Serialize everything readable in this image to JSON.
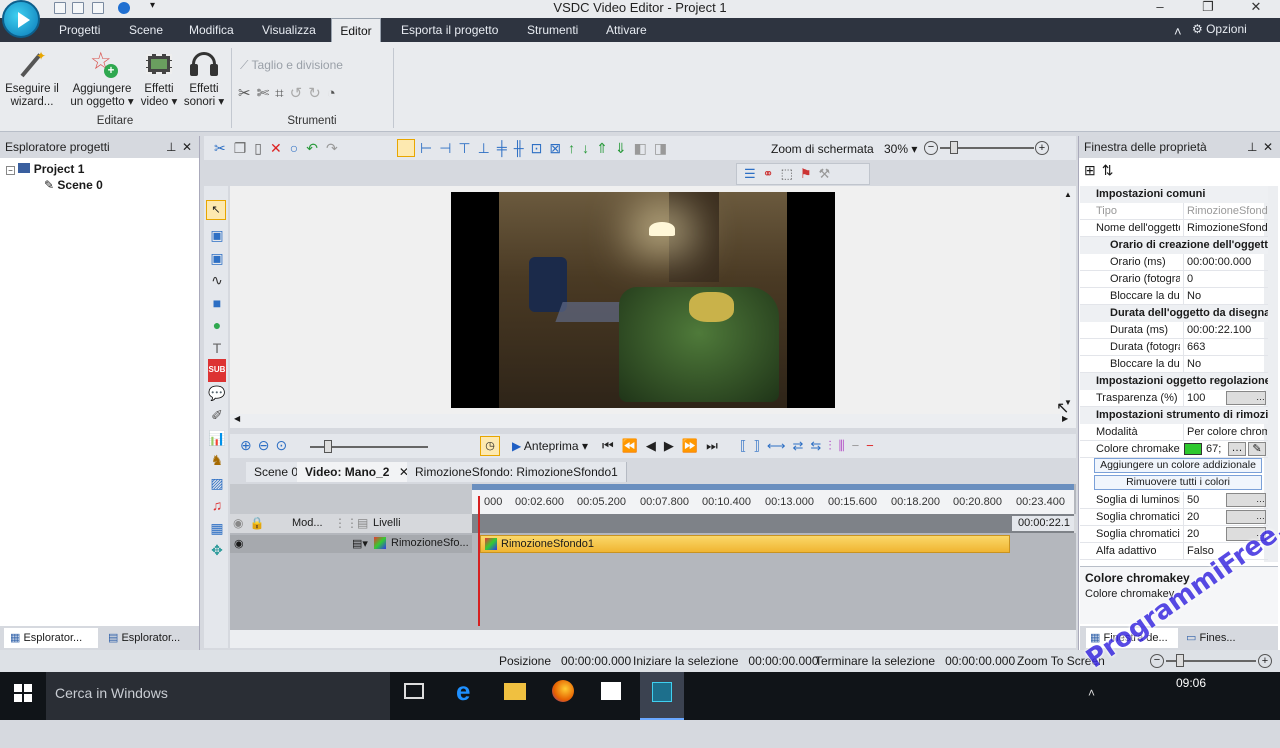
{
  "window": {
    "title": "VSDC Video Editor - Project 1"
  },
  "menu": {
    "items": [
      "Progetti",
      "Scene",
      "Modifica",
      "Visualizza",
      "Editor",
      "Esporta il progetto",
      "Strumenti",
      "Attivare"
    ],
    "opzioni": "Opzioni"
  },
  "ribbon": {
    "wizard": [
      "Eseguire il",
      "wizard..."
    ],
    "add_object": [
      "Aggiungere",
      "un oggetto"
    ],
    "video_effects": [
      "Effetti",
      "video"
    ],
    "sound_effects": [
      "Effetti",
      "sonori"
    ],
    "group_edit": "Editare",
    "cut_split": "Taglio e divisione",
    "group_tools": "Strumenti"
  },
  "project_explorer": {
    "title": "Esploratore progetti",
    "project": "Project 1",
    "scene": "Scene 0",
    "tab1": "Esplorator...",
    "tab2": "Esplorator..."
  },
  "toolbar": {
    "zoom_label": "Zoom di schermata",
    "zoom_value": "30%"
  },
  "timeline": {
    "preview_label": "Anteprima",
    "tabs": [
      "Scene 0",
      "Video: Mano_2",
      "RimozioneSfondo: RimozioneSfondo1"
    ],
    "ticks": [
      "000",
      "00:02.600",
      "00:05.200",
      "00:07.800",
      "00:10.400",
      "00:13.000",
      "00:15.600",
      "00:18.200",
      "00:20.800",
      "00:23.400"
    ],
    "end_time": "00:00:22.1",
    "header_mode": "Mod...",
    "header_levels": "Livelli",
    "track_name": "RimozioneSfo...",
    "clip_label": "RimozioneSfondo1"
  },
  "properties": {
    "title": "Finestra delle proprietà",
    "sec_common": "Impostazioni comuni",
    "tipo_k": "Tipo",
    "tipo_v": "RimozioneSfondo",
    "nome_k": "Nome dell'oggetto",
    "nome_v": "RimozioneSfondo",
    "sec_creation": "Orario di creazione dell'oggetto",
    "orario_ms_k": "Orario (ms)",
    "orario_ms_v": "00:00:00.000",
    "orario_f_k": "Orario (fotogrammi)",
    "orario_f_v": "0",
    "blocc1_k": "Bloccare la durata",
    "blocc1_v": "No",
    "sec_duration": "Durata dell'oggetto da disegnare",
    "durata_ms_k": "Durata (ms)",
    "durata_ms_v": "00:00:22.100",
    "durata_f_k": "Durata (fotogrammi)",
    "durata_f_v": "663",
    "blocc2_k": "Bloccare la durata",
    "blocc2_v": "No",
    "sec_adjust": "Impostazioni oggetto regolazione",
    "trasp_k": "Trasparenza (%)",
    "trasp_v": "100",
    "sec_tool": "Impostazioni strumento di rimozione",
    "mod_k": "Modalità",
    "mod_v": "Per colore chromakey",
    "colore_k": "Colore chromakey",
    "colore_v": "67;",
    "add_color_btn": "Aggiungere un colore addizionale",
    "remove_colors_btn": "Rimuovere tutti i colori",
    "soglia_lum_k": "Soglia di luminosità",
    "soglia_lum_v": "50",
    "soglia_c1_k": "Soglia chromaticità",
    "soglia_c1_v": "20",
    "soglia_c2_k": "Soglia chromaticità",
    "soglia_c2_v": "20",
    "alfa_k": "Alfa adattivo",
    "alfa_v": "Falso",
    "desc_title": "Colore chromakey",
    "desc_text": "Colore chromakey",
    "tab1": "Finestra de...",
    "tab2": "Fines..."
  },
  "status": {
    "pos_label": "Posizione",
    "pos_value": "00:00:00.000",
    "sel_start_label": "Iniziare la selezione",
    "sel_start_value": "00:00:00.000",
    "sel_end_label": "Terminare la selezione",
    "sel_end_value": "00:00:00.000",
    "zoom_label": "Zoom To Screen"
  },
  "taskbar": {
    "search": "Cerca in Windows",
    "time": "09:06"
  },
  "watermark": "ProgrammiFree.com",
  "colors": {
    "menubar": "#2e3440",
    "chroma": "#2ec82e",
    "clip": "#f5c542",
    "playhead": "#d62020",
    "taskbar": "#101418"
  }
}
